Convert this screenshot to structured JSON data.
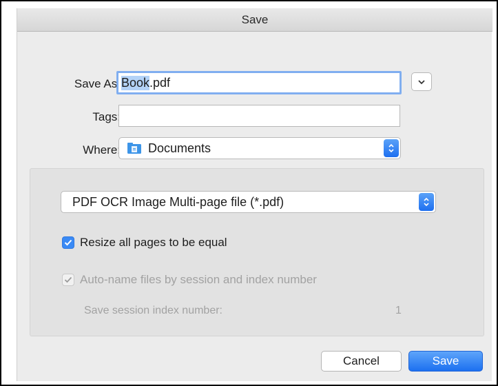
{
  "window": {
    "title": "Save"
  },
  "form": {
    "save_as_label": "Save As:",
    "filename_selected": "Book",
    "filename_rest": ".pdf",
    "tags_label": "Tags:",
    "tags_value": "",
    "where_label": "Where:",
    "where_value": "Documents"
  },
  "options": {
    "format_value": "PDF OCR Image Multi-page file (*.pdf)",
    "resize_label": "Resize all pages to be equal",
    "resize_checked": true,
    "autoname_label": "Auto-name files by session and index number",
    "autoname_checked": true,
    "autoname_enabled": false,
    "session_label": "Save session index number:",
    "session_value": "1"
  },
  "buttons": {
    "cancel": "Cancel",
    "save": "Save"
  },
  "colors": {
    "accent": "#1c70f0",
    "selection": "#b3d2f7",
    "focus_ring": "#80aef0",
    "disabled_text": "#a2a2a2"
  },
  "icons": {
    "expand": "chevron-down-icon",
    "where": "folder-icon",
    "popup": "updown-arrows-icon",
    "check": "checkmark-icon"
  }
}
